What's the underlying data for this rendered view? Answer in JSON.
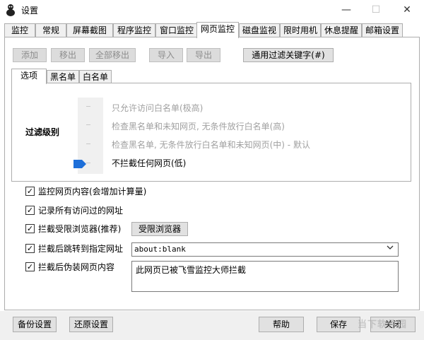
{
  "window": {
    "title": "设置",
    "controls": {
      "minimize": "—",
      "maximize": "☐",
      "close": "✕"
    }
  },
  "main_tabs": [
    "监控",
    "常规",
    "屏幕截图",
    "程序监控",
    "窗口监控",
    "网页监控",
    "磁盘监视",
    "限时用机",
    "休息提醒",
    "邮箱设置"
  ],
  "active_main_tab": "网页监控",
  "toolbar": {
    "add": "添加",
    "remove": "移出",
    "remove_all": "全部移出",
    "import": "导入",
    "export": "导出",
    "wildcard_filter": "通用过滤关键字(#)"
  },
  "inner_tabs": [
    "选项",
    "黑名单",
    "白名单"
  ],
  "active_inner_tab": "选项",
  "filter": {
    "label": "过滤级别",
    "levels": [
      "只允许访问白名单(极高)",
      "检查黑名单和未知网页, 无条件放行白名单(高)",
      "检查黑名单, 无条件放行白名单和未知网页(中) - 默认",
      "不拦截任何网页(低)"
    ],
    "current_level": "不拦截任何网页(低)"
  },
  "options": {
    "monitor_content": {
      "label": "监控网页内容(会增加计算量)",
      "checked": true
    },
    "record_urls": {
      "label": "记录所有访问过的网址",
      "checked": true
    },
    "block_restricted_browsers": {
      "label": "拦截受限浏览器(推荐)",
      "checked": true,
      "button": "受限浏览器"
    },
    "redirect_after_block": {
      "label": "拦截后跳转到指定网址",
      "checked": true,
      "value": "about:blank"
    },
    "fake_page_after_block": {
      "label": "拦截后伪装网页内容",
      "checked": true,
      "value": "此网页已被飞雪监控大师拦截"
    }
  },
  "footer": {
    "backup": "备份设置",
    "restore": "还原设置",
    "help": "帮助",
    "save": "保存",
    "close": "关闭"
  },
  "watermark": "当下软件园",
  "colors": {
    "slider_thumb": "#1e6fd9",
    "panel_bg": "#f0f0f0",
    "border": "#adadad"
  }
}
